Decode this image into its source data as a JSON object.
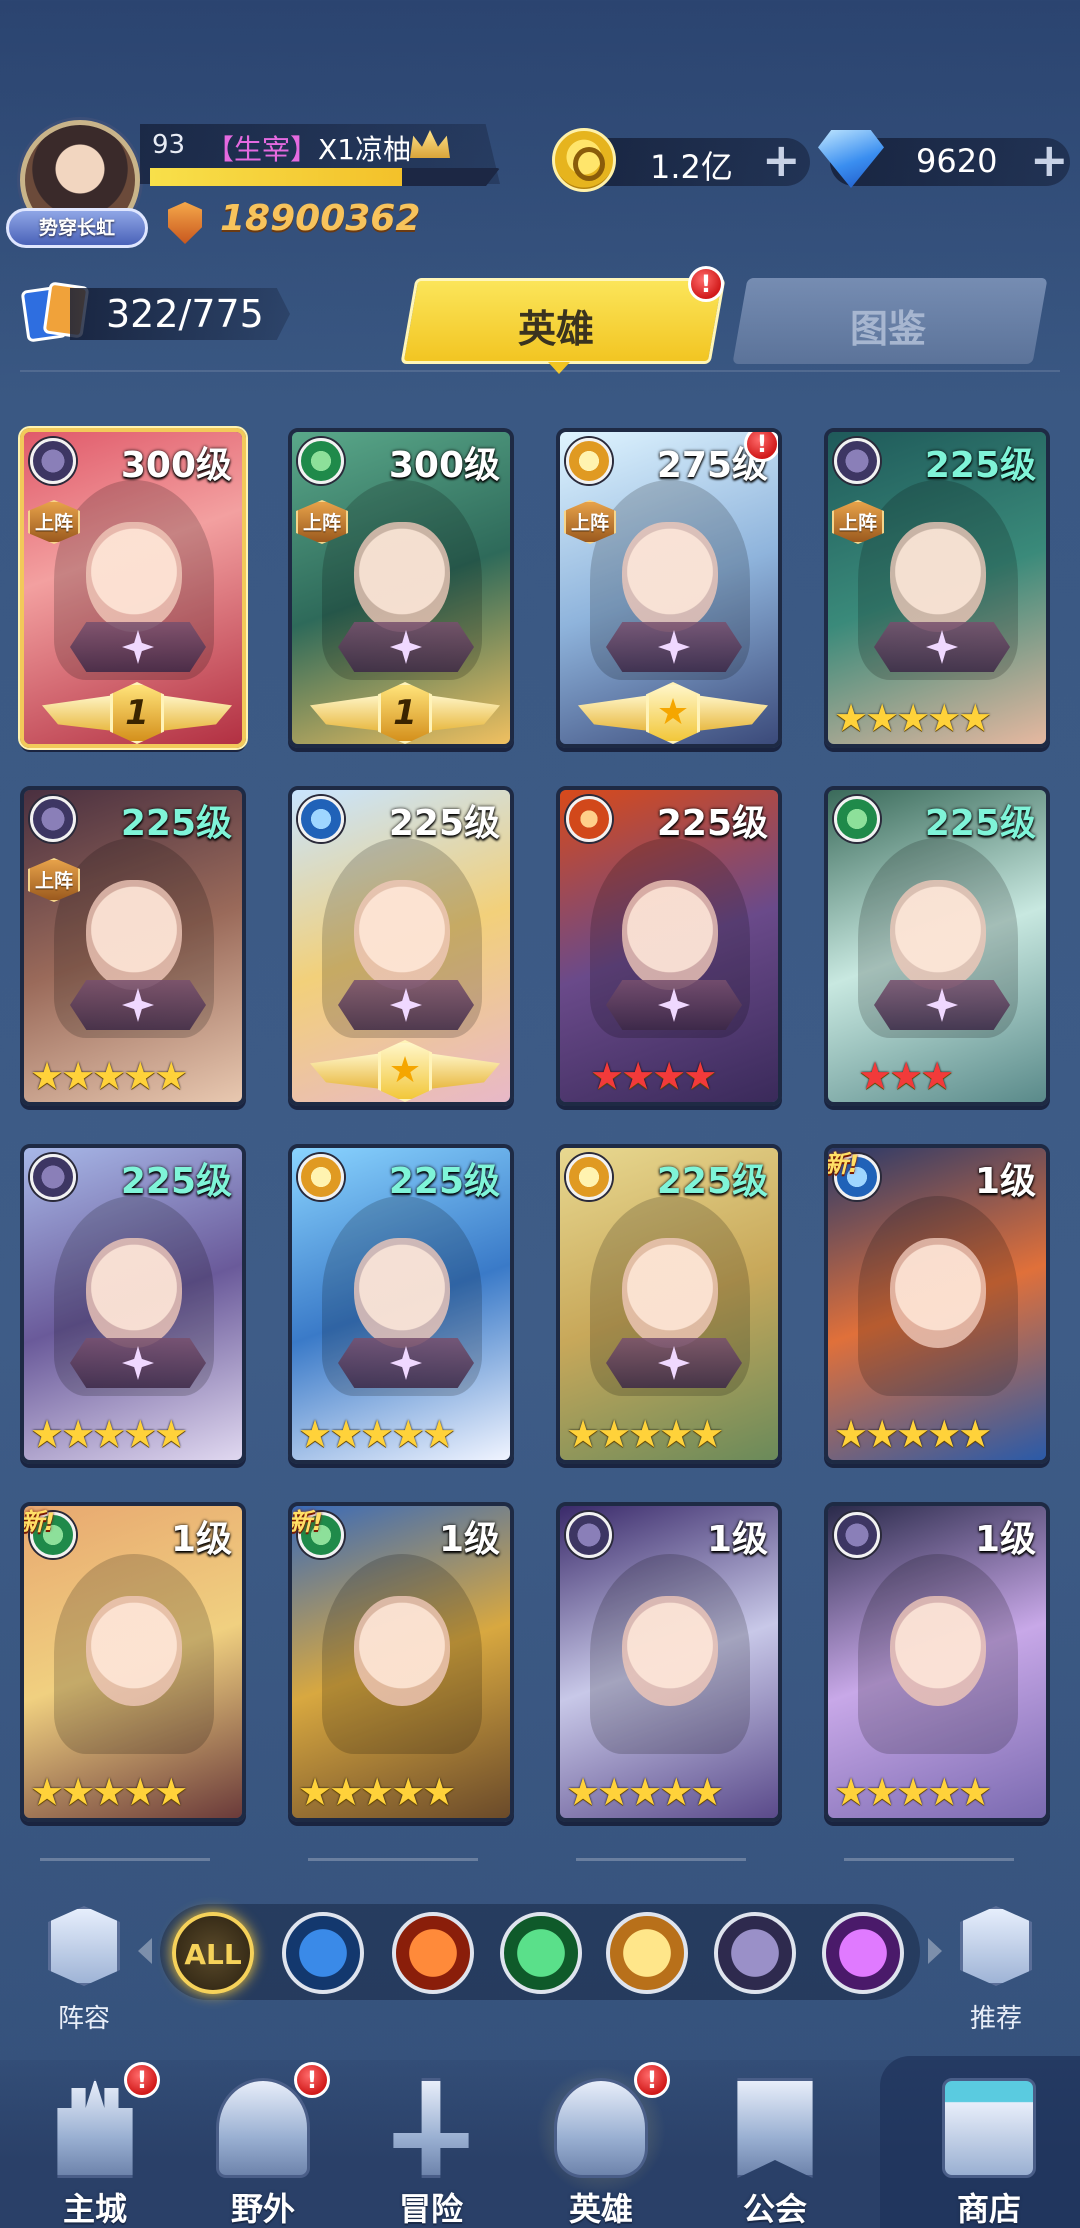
{
  "player": {
    "level": "93",
    "guild_tag": "【生宰】",
    "name": "X1凉柚",
    "title_badge": "势穿长虹",
    "power": "18900362",
    "exp_fraction": 0.72
  },
  "resources": {
    "gold": "1.2亿",
    "diamonds": "9620",
    "plus": "+"
  },
  "collection": {
    "count": "322/775"
  },
  "tabs": {
    "heroes": "英雄",
    "codex": "图鉴",
    "alert": "!"
  },
  "heroes": [
    {
      "level": "300级",
      "faction": "shadow",
      "deployed": true,
      "rank": "1",
      "stars": 0,
      "star_color": "none",
      "new": false,
      "alert": false
    },
    {
      "level": "300级",
      "faction": "nature",
      "deployed": true,
      "rank": "1",
      "stars": 0,
      "star_color": "none",
      "new": false,
      "alert": false
    },
    {
      "level": "275级",
      "faction": "light",
      "deployed": true,
      "rank": "★",
      "stars": 0,
      "star_color": "none",
      "new": false,
      "alert": true
    },
    {
      "level": "225级",
      "faction": "shadow",
      "deployed": true,
      "rank": "",
      "stars": 5,
      "star_color": "yellow",
      "new": false,
      "alert": false
    },
    {
      "level": "225级",
      "faction": "shadow",
      "deployed": true,
      "rank": "",
      "stars": 5,
      "star_color": "yellow",
      "new": false,
      "alert": false
    },
    {
      "level": "225级",
      "faction": "water",
      "deployed": false,
      "rank": "★",
      "stars": 0,
      "star_color": "none",
      "new": false,
      "alert": false
    },
    {
      "level": "225级",
      "faction": "fire",
      "deployed": false,
      "rank": "",
      "stars": 4,
      "star_color": "red",
      "new": false,
      "alert": false
    },
    {
      "level": "225级",
      "faction": "nature",
      "deployed": false,
      "rank": "",
      "stars": 3,
      "star_color": "red",
      "new": false,
      "alert": false
    },
    {
      "level": "225级",
      "faction": "shadow",
      "deployed": false,
      "rank": "",
      "stars": 5,
      "star_color": "yellow",
      "new": false,
      "alert": false
    },
    {
      "level": "225级",
      "faction": "light",
      "deployed": false,
      "rank": "",
      "stars": 5,
      "star_color": "yellow",
      "new": false,
      "alert": false
    },
    {
      "level": "225级",
      "faction": "light",
      "deployed": false,
      "rank": "",
      "stars": 5,
      "star_color": "yellow",
      "new": false,
      "alert": false
    },
    {
      "level": "1级",
      "faction": "water",
      "deployed": false,
      "rank": "",
      "stars": 5,
      "star_color": "yellow",
      "new": true,
      "alert": false
    },
    {
      "level": "1级",
      "faction": "nature",
      "deployed": false,
      "rank": "",
      "stars": 5,
      "star_color": "yellow",
      "new": true,
      "alert": false
    },
    {
      "level": "1级",
      "faction": "nature",
      "deployed": false,
      "rank": "",
      "stars": 5,
      "star_color": "yellow",
      "new": true,
      "alert": false
    },
    {
      "level": "1级",
      "faction": "shadow",
      "deployed": false,
      "rank": "",
      "stars": 5,
      "star_color": "yellow",
      "new": false,
      "alert": false
    },
    {
      "level": "1级",
      "faction": "shadow",
      "deployed": false,
      "rank": "",
      "stars": 5,
      "star_color": "yellow",
      "new": false,
      "alert": false
    }
  ],
  "labels": {
    "deployed": "上阵",
    "new": "新!"
  },
  "filters": {
    "all": "ALL",
    "lineup": "阵容",
    "recommend": "推荐"
  },
  "nav": {
    "main_city": "主城",
    "wild": "野外",
    "adventure": "冒险",
    "heroes": "英雄",
    "guild": "公会",
    "shop": "商店"
  }
}
